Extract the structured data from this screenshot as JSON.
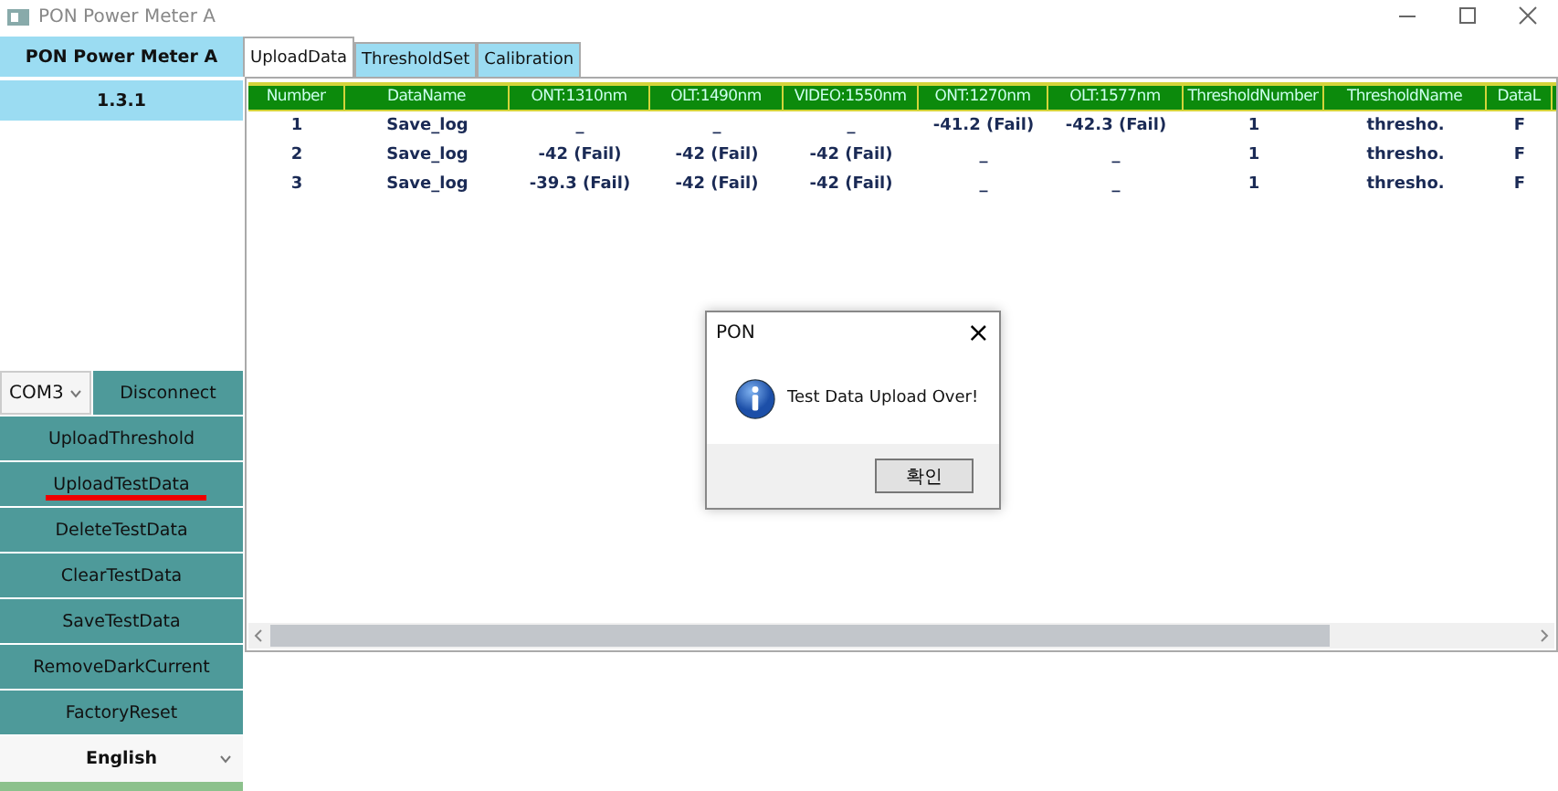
{
  "window": {
    "title": "PON Power Meter A"
  },
  "sidebar": {
    "header": "PON Power Meter A",
    "version": "1.3.1",
    "port": {
      "value": "COM3"
    },
    "connect_button": "Disconnect",
    "buttons": [
      {
        "label": "UploadThreshold",
        "underlined": false
      },
      {
        "label": "UploadTestData",
        "underlined": true
      },
      {
        "label": "DeleteTestData",
        "underlined": false
      },
      {
        "label": "ClearTestData",
        "underlined": false
      },
      {
        "label": "SaveTestData",
        "underlined": false
      },
      {
        "label": "RemoveDarkCurrent",
        "underlined": false
      },
      {
        "label": "FactoryReset",
        "underlined": false
      }
    ],
    "language": {
      "value": "English"
    }
  },
  "tabs": [
    {
      "label": "UploadData",
      "selected": true
    },
    {
      "label": "ThresholdSet",
      "selected": false
    },
    {
      "label": "Calibration",
      "selected": false
    }
  ],
  "table": {
    "columns": [
      "Number",
      "DataName",
      "ONT:1310nm",
      "OLT:1490nm",
      "VIDEO:1550nm",
      "ONT:1270nm",
      "OLT:1577nm",
      "ThresholdNumber",
      "ThresholdName",
      "DataL"
    ],
    "rows": [
      [
        "1",
        "Save_log",
        "_",
        "_",
        "_",
        "-41.2 (Fail)",
        "-42.3 (Fail)",
        "1",
        "thresho.",
        "F"
      ],
      [
        "2",
        "Save_log",
        "-42 (Fail)",
        "-42 (Fail)",
        "-42 (Fail)",
        "_",
        "_",
        "1",
        "thresho.",
        "F"
      ],
      [
        "3",
        "Save_log",
        "-39.3 (Fail)",
        "-42 (Fail)",
        "-42 (Fail)",
        "_",
        "_",
        "1",
        "thresho.",
        "F"
      ]
    ]
  },
  "dialog": {
    "title": "PON",
    "close": "×",
    "message": "Test Data Upload Over!",
    "button": "확인"
  }
}
